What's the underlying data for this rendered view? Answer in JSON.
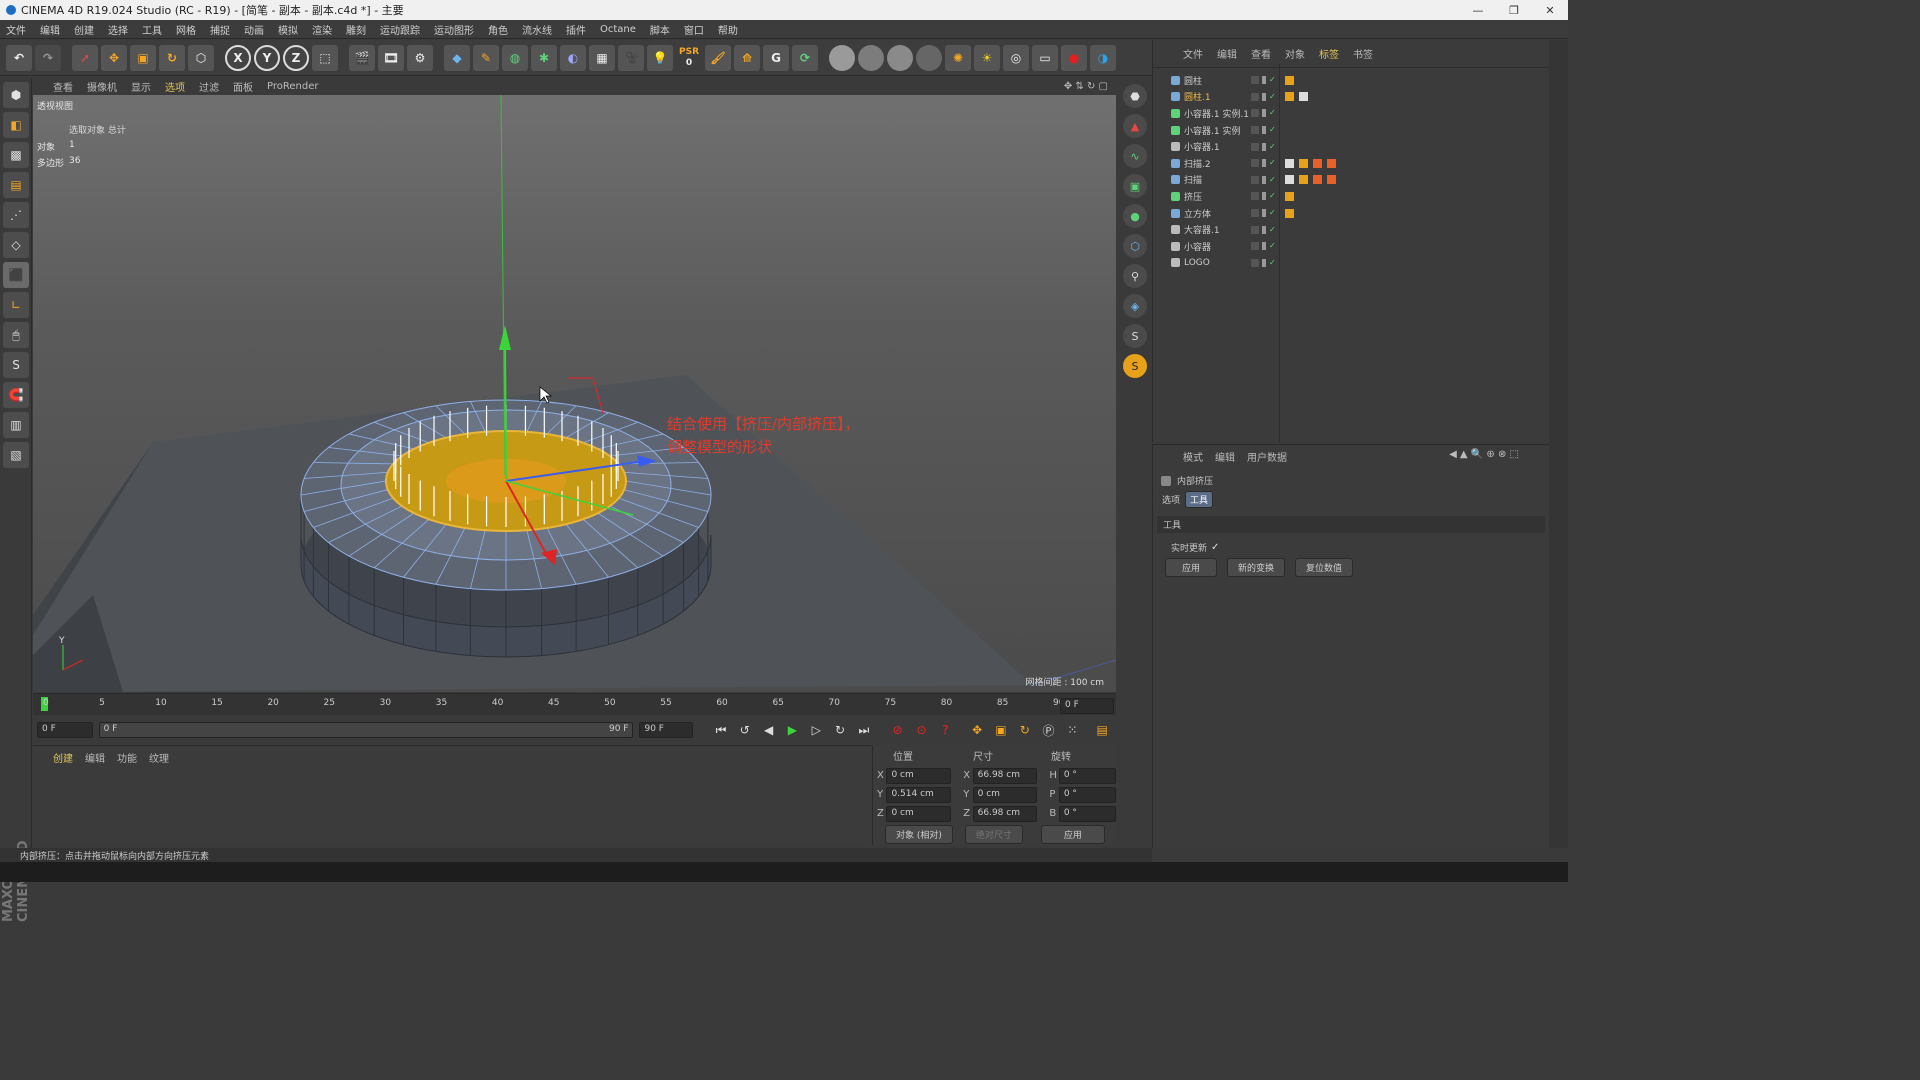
{
  "window": {
    "title": "CINEMA 4D R19.024 Studio (RC - R19) - [简笔 - 副本 - 副本.c4d *] - 主要"
  },
  "menu": [
    "文件",
    "编辑",
    "创建",
    "选择",
    "工具",
    "网格",
    "捕捉",
    "动画",
    "模拟",
    "渲染",
    "雕刻",
    "运动跟踪",
    "运动图形",
    "角色",
    "流水线",
    "插件",
    "Octane",
    "脚本",
    "窗口",
    "帮助"
  ],
  "toolbar": {
    "axis_x": "X",
    "axis_y": "Y",
    "axis_z": "Z",
    "psr_label": "PSR",
    "psr_value": "0"
  },
  "viewport": {
    "menu": [
      "查看",
      "摄像机",
      "显示",
      "选项",
      "过滤",
      "面板",
      "ProRender"
    ],
    "active_menu": "选项",
    "name": "透视视图",
    "info_header": "选取对象 总计",
    "info_objects_label": "对象",
    "info_objects_value": "1",
    "info_polys_label": "多边形",
    "info_polys_value": "36",
    "grid_distance": "网格间距 : 100 cm",
    "annotation_line1": "结合使用【挤压/内部挤压】，",
    "annotation_line2": "调整模型的形状"
  },
  "timeline": {
    "ticks": [
      "0",
      "5",
      "10",
      "15",
      "20",
      "25",
      "30",
      "35",
      "40",
      "45",
      "50",
      "55",
      "60",
      "65",
      "70",
      "75",
      "80",
      "85",
      "90"
    ],
    "current_frame_field": "0 F",
    "start_field": "0 F",
    "range_start": "0 F",
    "range_end": "90 F",
    "end_field": "90 F"
  },
  "material_manager": {
    "tabs": [
      "创建",
      "编辑",
      "功能",
      "纹理"
    ]
  },
  "coordinates": {
    "headers": [
      "位置",
      "尺寸",
      "旋转"
    ],
    "rows": [
      {
        "axis": "X",
        "pos": "0 cm",
        "size_axis": "X",
        "size": "66.98 cm",
        "rot_axis": "H",
        "rot": "0 °"
      },
      {
        "axis": "Y",
        "pos": "0.514 cm",
        "size_axis": "Y",
        "size": "0 cm",
        "rot_axis": "P",
        "rot": "0 °"
      },
      {
        "axis": "Z",
        "pos": "0 cm",
        "size_axis": "Z",
        "size": "66.98 cm",
        "rot_axis": "B",
        "rot": "0 °"
      }
    ],
    "mode_select": "对象 (相对)",
    "size_select": "绝对尺寸",
    "apply": "应用"
  },
  "object_manager": {
    "menu": [
      "文件",
      "编辑",
      "查看",
      "对象",
      "标签",
      "书签"
    ],
    "active_menu": "标签",
    "objects": [
      {
        "name": "圆柱",
        "selected": false
      },
      {
        "name": "圆柱.1",
        "selected": true
      },
      {
        "name": "小容器.1 实例.1",
        "selected": false
      },
      {
        "name": "小容器.1 实例",
        "selected": false
      },
      {
        "name": "小容器.1",
        "selected": false
      },
      {
        "name": "扫描.2",
        "selected": false
      },
      {
        "name": "扫描",
        "selected": false
      },
      {
        "name": "挤压",
        "selected": false
      },
      {
        "name": "立方体",
        "selected": false
      },
      {
        "name": "大容器.1",
        "selected": false
      },
      {
        "name": "小容器",
        "selected": false
      },
      {
        "name": "LOGO",
        "selected": false
      }
    ]
  },
  "attribute_manager": {
    "menu": [
      "模式",
      "编辑",
      "用户数据"
    ],
    "tool_name": "内部挤压",
    "tabs": [
      "选项",
      "工具"
    ],
    "active_tab": "工具",
    "section": "工具",
    "realtime_label": "实时更新",
    "realtime_checked": "✓",
    "buttons": [
      "应用",
      "新的变换",
      "复位数值"
    ]
  },
  "statusbar": {
    "text": "内部挤压：点击并拖动鼠标向内部方向挤压元素"
  },
  "branding": {
    "maxon": "MAXON CINEMA 4D"
  },
  "colors": {
    "selection_orange": "#e8a21a",
    "annotation_red": "#e23b2b",
    "active_yellow": "#e3c55a"
  }
}
